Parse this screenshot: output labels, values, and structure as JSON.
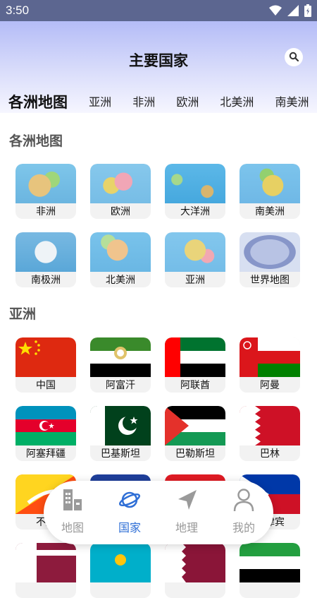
{
  "status_bar": {
    "time": "3:50"
  },
  "header": {
    "title": "主要国家"
  },
  "tabs": [
    {
      "label": "各洲地图",
      "active": true
    },
    {
      "label": "亚洲"
    },
    {
      "label": "非洲"
    },
    {
      "label": "欧洲"
    },
    {
      "label": "北美洲"
    },
    {
      "label": "南美洲"
    }
  ],
  "sections": {
    "continents": {
      "title": "各洲地图",
      "items": [
        {
          "label": "非洲"
        },
        {
          "label": "欧洲"
        },
        {
          "label": "大洋洲"
        },
        {
          "label": "南美洲"
        },
        {
          "label": "南极洲"
        },
        {
          "label": "北美洲"
        },
        {
          "label": "亚洲"
        },
        {
          "label": "世界地图"
        }
      ]
    },
    "asia": {
      "title": "亚洲",
      "items": [
        {
          "label": "中国"
        },
        {
          "label": "阿富汗"
        },
        {
          "label": "阿联酋"
        },
        {
          "label": "阿曼"
        },
        {
          "label": "阿塞拜疆"
        },
        {
          "label": "巴基斯坦"
        },
        {
          "label": "巴勒斯坦"
        },
        {
          "label": "巴林"
        },
        {
          "label": "不丹"
        },
        {
          "label": "菲律宾"
        }
      ]
    }
  },
  "bottom_nav": [
    {
      "label": "地图",
      "icon": "buildings-icon"
    },
    {
      "label": "国家",
      "icon": "planet-icon",
      "active": true
    },
    {
      "label": "地理",
      "icon": "navigation-arrow-icon"
    },
    {
      "label": "我的",
      "icon": "user-icon"
    }
  ],
  "colors": {
    "active": "#2f6fd6",
    "inactive": "#999999",
    "status_bar": "#5c6690"
  }
}
